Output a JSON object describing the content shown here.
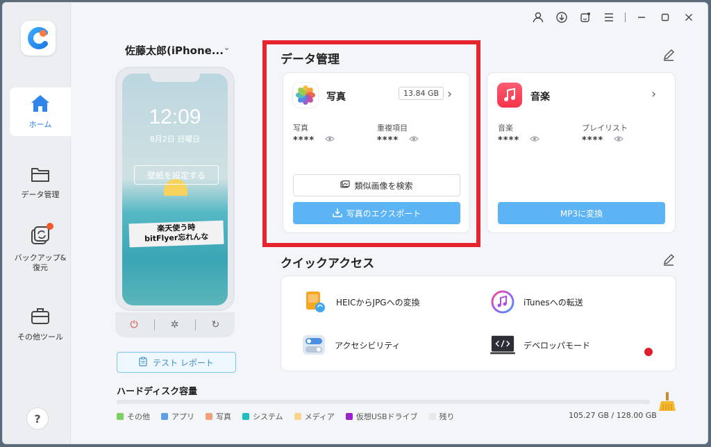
{
  "sidebar": {
    "items": [
      {
        "label": "ホーム",
        "icon": "home-icon"
      },
      {
        "label": "データ管理",
        "icon": "folder-icon"
      },
      {
        "label": "バックアップ&復元",
        "icon": "backup-icon"
      },
      {
        "label": "その他ツール",
        "icon": "toolbox-icon"
      }
    ],
    "help_label": "?"
  },
  "device": {
    "name": "佐藤太郎(iPhone...",
    "time": "12:09",
    "date": "8月2日 日曜日",
    "wallpaper_button": "壁紙を設定する",
    "sign_line1": "楽天使う時",
    "sign_line2": "bitFlyer忘れんな",
    "test_report": "テスト レポート"
  },
  "data_management": {
    "title": "データ管理",
    "photos": {
      "title": "写真",
      "size": "13.84 GB",
      "stat1_label": "写真",
      "stat1_value": "****",
      "stat2_label": "重複項目",
      "stat2_value": "****",
      "similar_button": "類似画像を検索",
      "export_button": "写真のエクスポート"
    },
    "music": {
      "title": "音楽",
      "stat1_label": "音楽",
      "stat1_value": "****",
      "stat2_label": "プレイリスト",
      "stat2_value": "****",
      "convert_button": "MP3に変換"
    }
  },
  "quick_access": {
    "title": "クイックアクセス",
    "items": [
      {
        "label": "HEICからJPGへの変換"
      },
      {
        "label": "iTunesへの転送"
      },
      {
        "label": "アクセシビリティ"
      },
      {
        "label": "デベロッパモード"
      }
    ]
  },
  "disk": {
    "title": "ハードディスク容量",
    "legend": [
      {
        "label": "その他",
        "color": "#7dcf63"
      },
      {
        "label": "アプリ",
        "color": "#5e9ee8"
      },
      {
        "label": "写真",
        "color": "#f4a07d"
      },
      {
        "label": "システム",
        "color": "#1fbfbd"
      },
      {
        "label": "メディア",
        "color": "#f7d58a"
      },
      {
        "label": "仮想USBドライブ",
        "color": "#9a23c9"
      },
      {
        "label": "残り",
        "color": "#e6e8ea"
      }
    ],
    "total": "105.27 GB / 128.00 GB"
  },
  "colors": {
    "accent": "#2a7ae8",
    "primary_button": "#5db4f4",
    "highlight": "#e4252f"
  }
}
